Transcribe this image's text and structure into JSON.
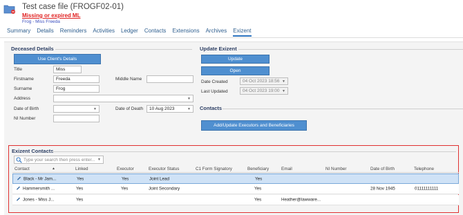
{
  "header": {
    "title": "Test case file (FROGF02-01)",
    "alert": "Missing or expired ML",
    "subtitle": "Frog - Miss Freeda"
  },
  "tabs": [
    {
      "label": "Summary",
      "active": false
    },
    {
      "label": "Details",
      "active": false
    },
    {
      "label": "Reminders",
      "active": false
    },
    {
      "label": "Activities",
      "active": false
    },
    {
      "label": "Ledger",
      "active": false
    },
    {
      "label": "Contacts",
      "active": false
    },
    {
      "label": "Extensions",
      "active": false
    },
    {
      "label": "Archives",
      "active": false
    },
    {
      "label": "Exizent",
      "active": true
    }
  ],
  "deceased": {
    "section_title": "Deceased Details",
    "use_client_button": "Use Client's Details",
    "title_label": "Title",
    "title_value": "Miss",
    "firstname_label": "Firstname",
    "firstname_value": "Freeda",
    "middlename_label": "Middle Name",
    "middlename_value": "",
    "surname_label": "Surname",
    "surname_value": "Frog",
    "address_label": "Address",
    "address_value": "",
    "dob_label": "Date of Birth",
    "dob_value": "",
    "dod_label": "Date of Death",
    "dod_value": "10 Aug 2023",
    "ni_label": "NI Number",
    "ni_value": ""
  },
  "update": {
    "section_title": "Update Exizent",
    "update_button": "Update",
    "open_button": "Open",
    "date_created_label": "Date Created",
    "date_created_value": "04 Oct 2023 18:56",
    "last_updated_label": "Last Updated",
    "last_updated_value": "04 Oct 2023 19:00"
  },
  "contacts_section": {
    "section_title": "Contacts",
    "add_button": "Add/Update Executors and Beneficiaries"
  },
  "exizent_contacts": {
    "section_title": "Exizent Contacts",
    "search_placeholder": "Type your search then press enter...",
    "columns": [
      "Contact",
      "Linked",
      "Executor",
      "Executor Status",
      "C1 Form Signatory",
      "Beneficiary",
      "Email",
      "NI Number",
      "Date of Birth",
      "Telephone"
    ],
    "rows": [
      {
        "contact": "Black - Mr Jam...",
        "linked": "Yes",
        "executor": "Yes",
        "status": "Joint Lead",
        "c1": "",
        "beneficiary": "Yes",
        "email": "",
        "ni": "",
        "dob": "",
        "telephone": "",
        "selected": true
      },
      {
        "contact": "Hammersmith ...",
        "linked": "Yes",
        "executor": "Yes",
        "status": "Joint Secondary",
        "c1": "",
        "beneficiary": "Yes",
        "email": "",
        "ni": "",
        "dob": "28 Nov 1945",
        "telephone": "01111111111",
        "selected": false
      },
      {
        "contact": "Jones - Miss J...",
        "linked": "Yes",
        "executor": "",
        "status": "",
        "c1": "",
        "beneficiary": "Yes",
        "email": "Heather@lawware...",
        "ni": "",
        "dob": "",
        "telephone": "",
        "selected": false
      }
    ]
  }
}
